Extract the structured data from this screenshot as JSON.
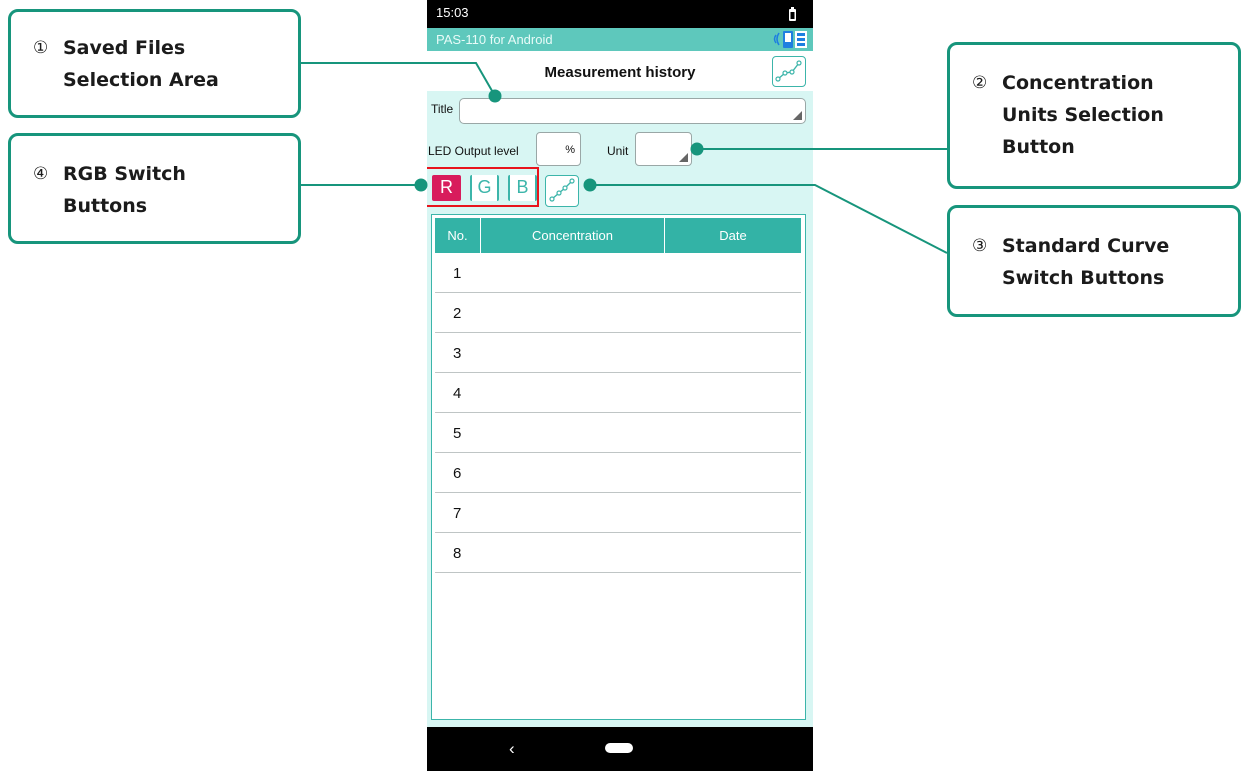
{
  "status_bar": {
    "time": "15:03",
    "battery_icon": "battery-icon"
  },
  "app_bar": {
    "title": "PAS-110 for Android",
    "device_icon": "bluetooth-device-icon"
  },
  "screen": {
    "title": "Measurement history",
    "title_field_label": "Title",
    "title_field_value": "",
    "led_label": "LED Output level",
    "led_value": "",
    "led_unit": "%",
    "unit_label": "Unit",
    "unit_value": "",
    "rgb_buttons": [
      "R",
      "G",
      "B"
    ],
    "rgb_selected": "R",
    "table": {
      "headers": [
        "No.",
        "Concentration",
        "Date"
      ],
      "rows": [
        {
          "no": "1",
          "concentration": "",
          "date": ""
        },
        {
          "no": "2",
          "concentration": "",
          "date": ""
        },
        {
          "no": "3",
          "concentration": "",
          "date": ""
        },
        {
          "no": "4",
          "concentration": "",
          "date": ""
        },
        {
          "no": "5",
          "concentration": "",
          "date": ""
        },
        {
          "no": "6",
          "concentration": "",
          "date": ""
        },
        {
          "no": "7",
          "concentration": "",
          "date": ""
        },
        {
          "no": "8",
          "concentration": "",
          "date": ""
        }
      ]
    }
  },
  "nav_bar": {
    "back_icon": "‹",
    "home_icon": "home-pill-icon"
  },
  "callouts": [
    {
      "num": "①",
      "text": "Saved Files\nSelection Area"
    },
    {
      "num": "②",
      "text": "Concentration\nUnits Selection\nButton"
    },
    {
      "num": "③",
      "text": "Standard Curve\nSwitch Buttons"
    },
    {
      "num": "④",
      "text": "RGB Switch\nButtons"
    }
  ],
  "colors": {
    "accent": "#33b3a6",
    "callout_border": "#17957c",
    "selected_red": "#d81c5c",
    "highlight": "#e8141c",
    "panel_bg": "#d8f6f3"
  }
}
